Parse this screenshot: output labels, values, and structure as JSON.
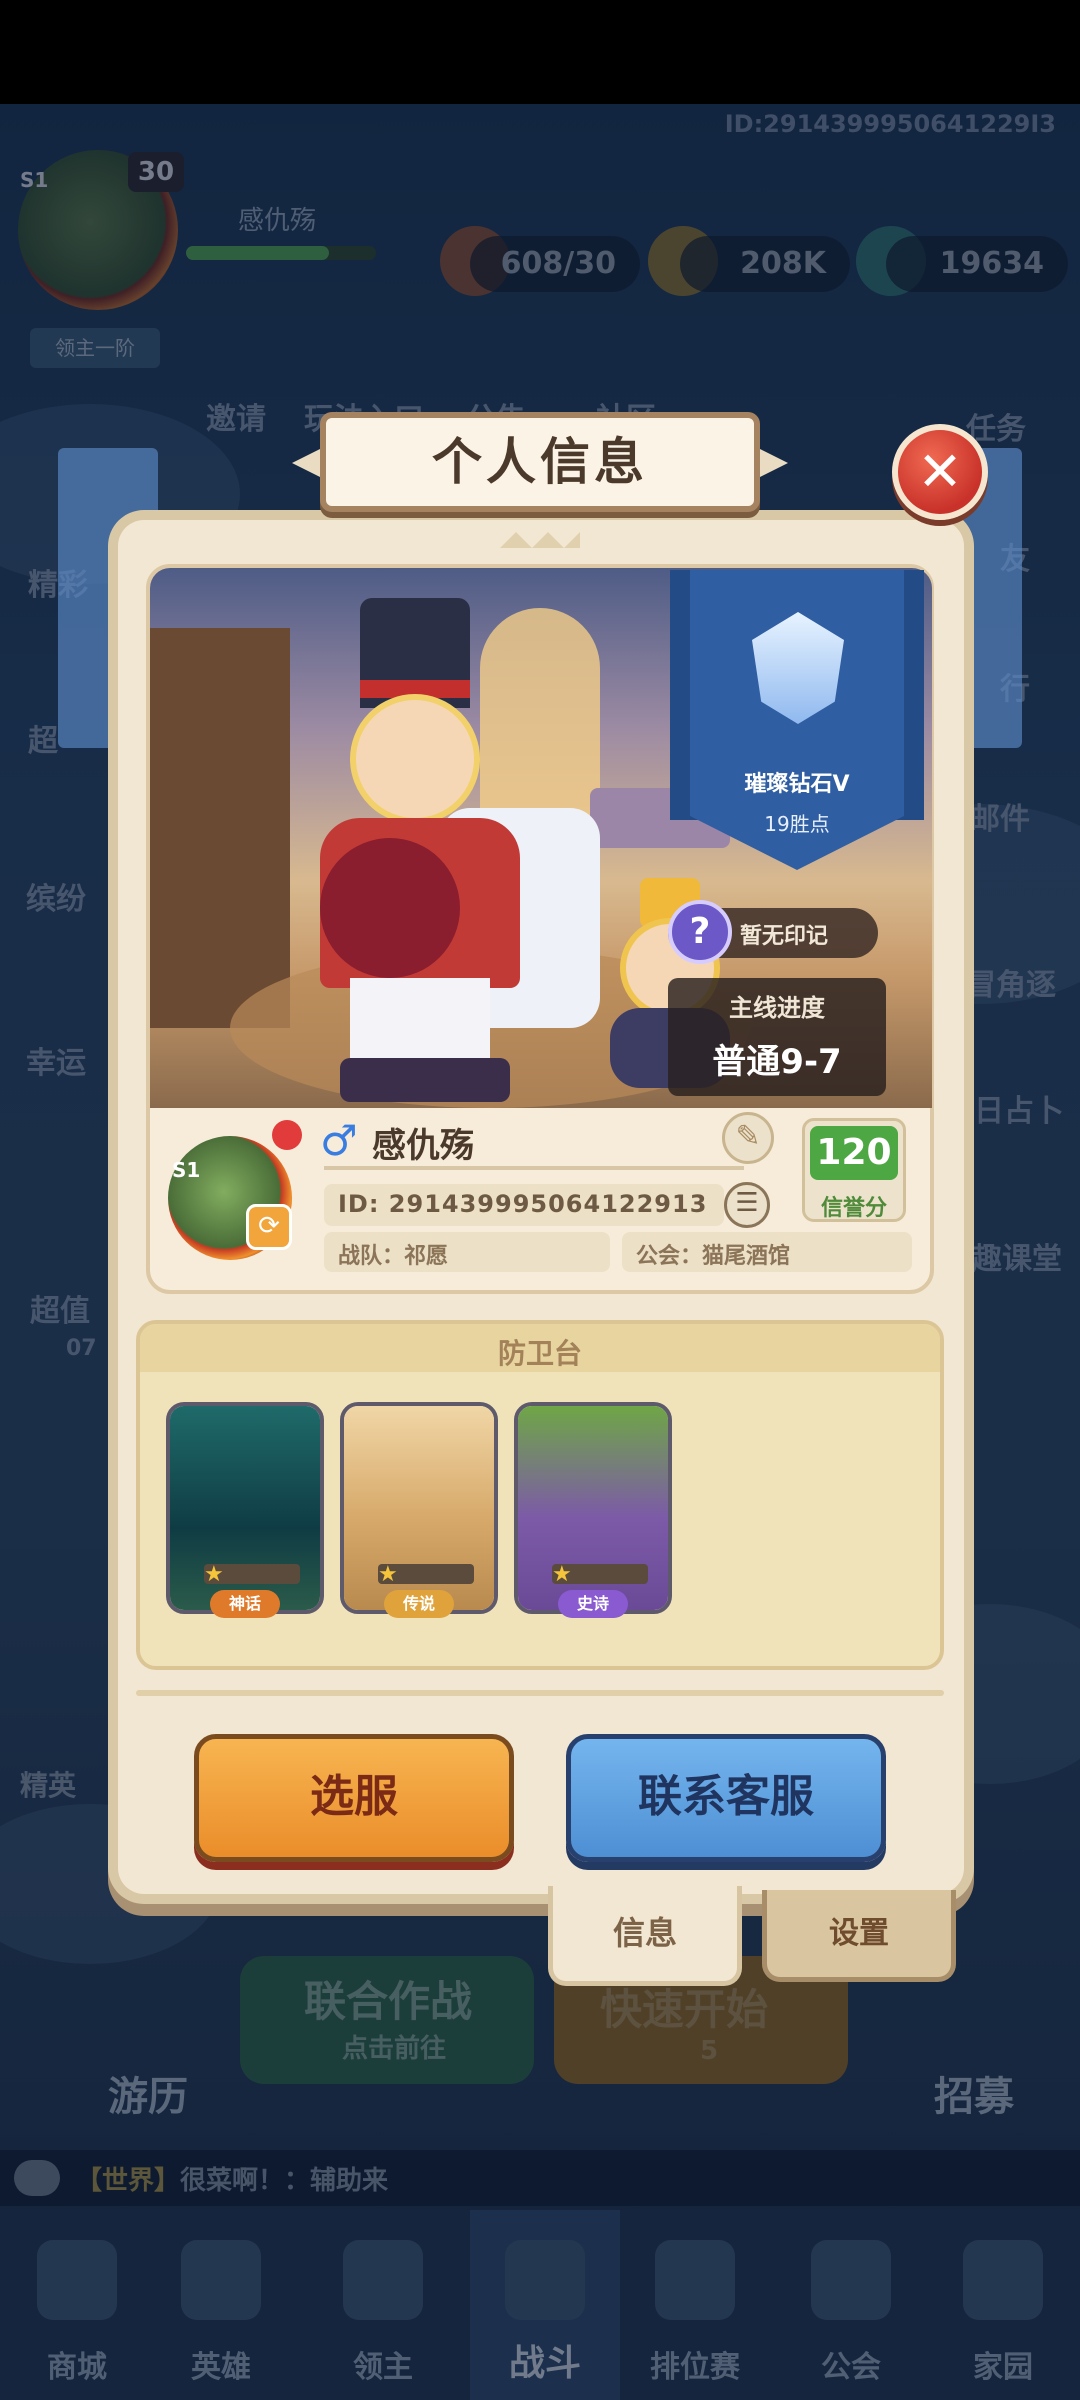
{
  "background": {
    "player_id_top": "ID:2914399950641229I3",
    "level": "30",
    "season_tag": "S1",
    "rank_ribbon": "领主一阶",
    "player_name_top": "感仇殇",
    "exp_fill": 0.75,
    "stamina": "608/30",
    "coins": "208K",
    "gems": "19634",
    "side_left": [
      "精彩",
      "超",
      "缤纷",
      "幸运",
      "超值",
      "07"
    ],
    "side_right": [
      "任务",
      "友",
      "行",
      "邮件",
      "冒角逐",
      "日占卜",
      "趣课堂"
    ],
    "top_shortcuts": [
      "邀请",
      "玩法入口",
      "公告",
      "社区"
    ],
    "big_buttons": {
      "coop_title": "联合作战",
      "coop_sub": "点击前往",
      "quick_start": "快速开始",
      "quick_cost": "5",
      "travel": "游历",
      "recruit": "招募",
      "elite": "精英"
    },
    "chat": {
      "channel": "【世界】",
      "message": "很菜啊！：辅助来"
    },
    "bottom_nav": [
      {
        "label": "商城"
      },
      {
        "label": "英雄"
      },
      {
        "label": "领主"
      },
      {
        "label": "战斗"
      },
      {
        "label": "排位赛"
      },
      {
        "label": "公会"
      },
      {
        "label": "家园"
      }
    ]
  },
  "dialog": {
    "title": "个人信息",
    "close_icon": "close-icon",
    "rank": {
      "name": "璀璨钻石V",
      "points": "19胜点"
    },
    "seal": {
      "icon": "?",
      "text": "暂无印记"
    },
    "progress": {
      "title": "主线进度",
      "value": "普通9-7"
    },
    "player": {
      "season_tag": "S1",
      "gender_icon": "♂",
      "name": "感仇殇",
      "id": "ID:  291439995064122913",
      "team": "战队：祁愿",
      "guild": "公会：猫尾酒馆",
      "credit_value": "120",
      "credit_label": "信誉分"
    },
    "defense": {
      "title": "防卫台",
      "towers": [
        {
          "tag": "神话",
          "color": "#e07a2b",
          "stars": 1
        },
        {
          "tag": "传说",
          "color": "#e0a23b",
          "stars": 1
        },
        {
          "tag": "史诗",
          "color": "#8a5ad1",
          "stars": 1
        }
      ]
    },
    "buttons": {
      "select_server": "选服",
      "contact_support": "联系客服"
    },
    "tabs": {
      "info": "信息",
      "settings": "设置"
    }
  }
}
